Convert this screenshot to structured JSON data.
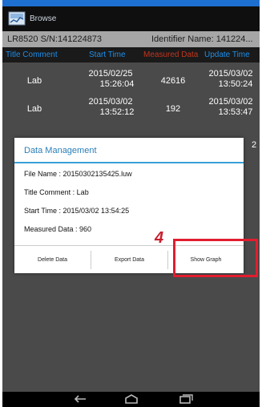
{
  "app": {
    "title": "Browse",
    "icon": "browse-app-icon"
  },
  "header": {
    "serial": "LR8520 S/N:141224873",
    "identifier": "Identifier Name: 141224..."
  },
  "table": {
    "columns": [
      "Title Comment",
      "Start Time",
      "Measured Data",
      "Update Time"
    ],
    "column_colors": [
      "#1e8ee8",
      "#1e8ee8",
      "#c2361f",
      "#1e8ee8"
    ],
    "rows": [
      {
        "comment": "Lab",
        "start_date": "2015/02/25",
        "start_time": "15:26:04",
        "measured": "42616",
        "update_date": "2015/03/02",
        "update_time": "13:50:24"
      },
      {
        "comment": "Lab",
        "start_date": "2015/03/02",
        "start_time": "13:52:12",
        "measured": "192",
        "update_date": "2015/03/02",
        "update_time": "13:53:47"
      }
    ],
    "partial_text": "2"
  },
  "dialog": {
    "title": "Data Management",
    "file_name": "File Name : 20150302135425.luw",
    "title_comment": "Title Comment : Lab",
    "start_time": "Start Time : 2015/03/02    13:54:25",
    "measured": "Measured Data : 960",
    "buttons": {
      "delete": "Delete Data",
      "export": "Export Data",
      "graph": "Show Graph"
    }
  },
  "annotation": {
    "step": "4",
    "color": "#e21d2f"
  },
  "colors": {
    "accent": "#1d6fd0",
    "dialog_title": "#2b7fb8"
  }
}
